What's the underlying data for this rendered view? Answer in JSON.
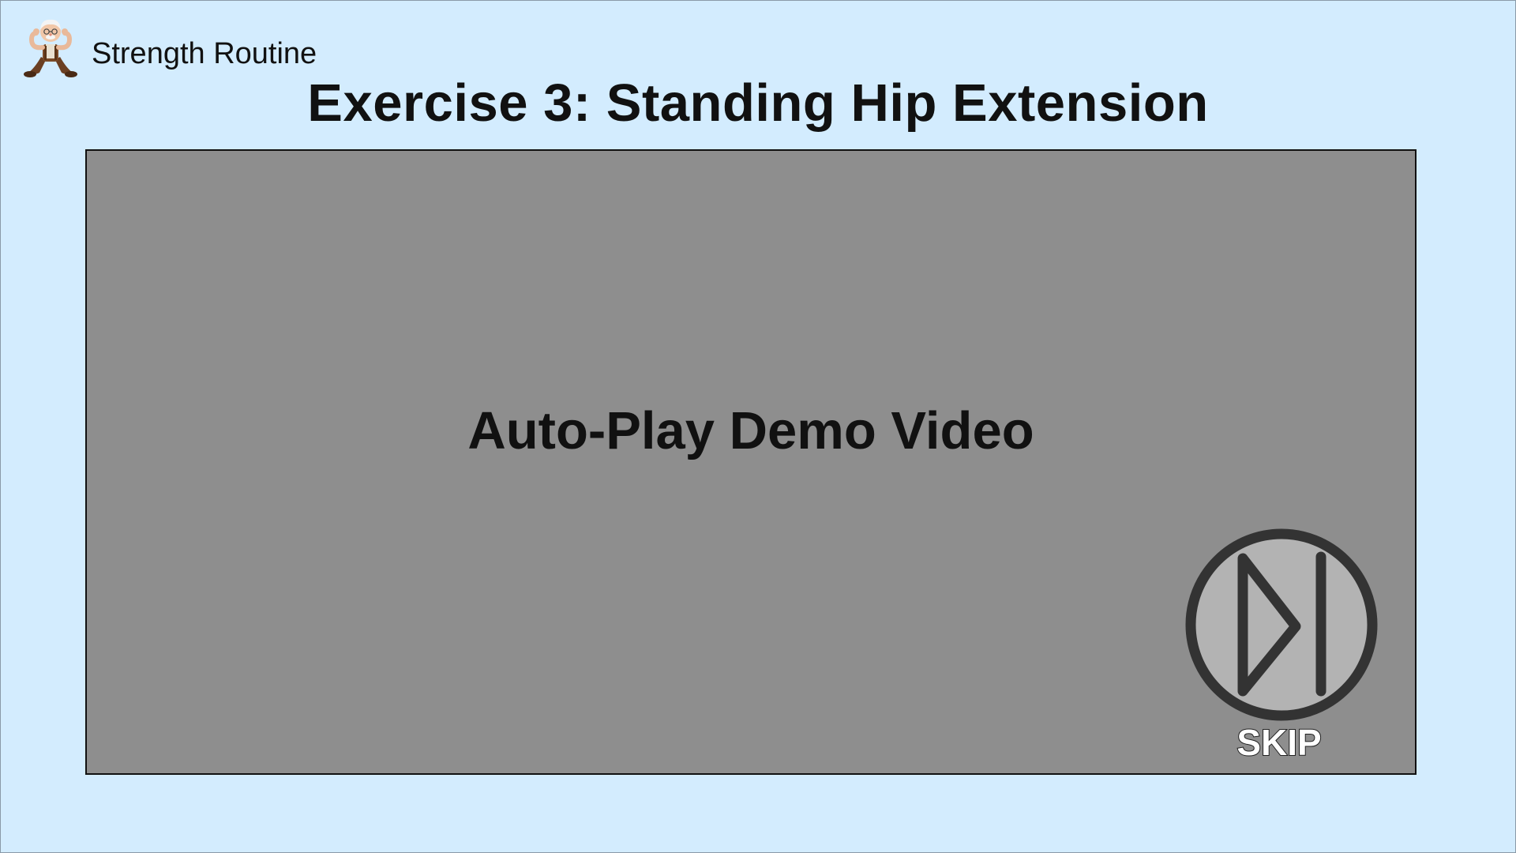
{
  "header": {
    "app_name": "Strength Routine",
    "avatar_icon": "elderly-person-flexing-icon"
  },
  "exercise": {
    "title": "Exercise 3: Standing Hip Extension"
  },
  "video": {
    "label": "Auto-Play Demo Video",
    "background_color": "#8e8e8e"
  },
  "skip": {
    "label": "SKIP",
    "icon": "skip-next-icon"
  },
  "colors": {
    "page_background": "#d3ecfe",
    "text": "#111111",
    "skip_icon_fill": "#b3b3b3",
    "skip_icon_stroke": "#333333"
  }
}
